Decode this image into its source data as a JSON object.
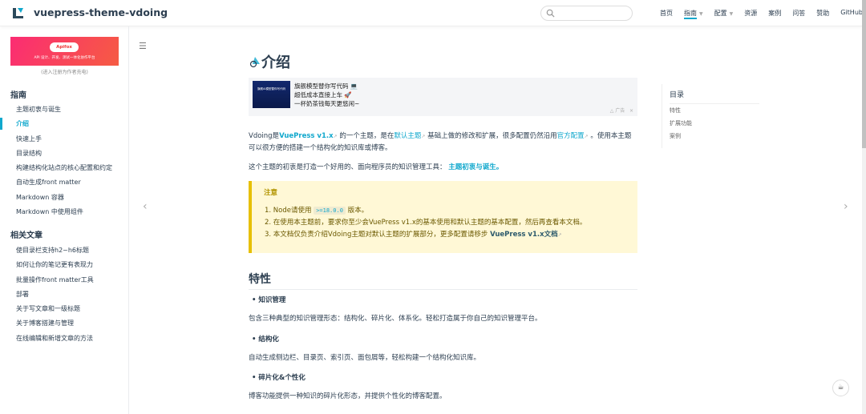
{
  "header": {
    "title": "vuepress-theme-vdoing",
    "search_placeholder": "",
    "nav": [
      {
        "label": "首页"
      },
      {
        "label": "指南",
        "caret": "▼"
      },
      {
        "label": "配置",
        "caret": "▼"
      },
      {
        "label": "资源"
      },
      {
        "label": "案例"
      },
      {
        "label": "问答"
      },
      {
        "label": "赞助"
      },
      {
        "label": "GitHub"
      }
    ]
  },
  "sidebar": {
    "ad": {
      "brand": "Apifox",
      "slogan": "API 设计、开发、测试一体化协作平台",
      "note": "(进入注册为作者充电)"
    },
    "groups": [
      {
        "title": "指南",
        "items": [
          "主题初衷与诞生",
          "介绍",
          "快速上手",
          "目录结构",
          "构建结构化站点的核心配置和约定",
          "自动生成front matter",
          "Markdown 容器",
          "Markdown 中使用组件"
        ]
      },
      {
        "title": "相关文章",
        "items": [
          "使目录栏支持h2~h6标题",
          "如何让你的笔记更有表现力",
          "批量操作front matter工具",
          "部署",
          "关于写文章和一级标题",
          "关于博客搭建与管理",
          "在线编辑和新增文章的方法"
        ]
      }
    ]
  },
  "content": {
    "title": "介绍",
    "banner": {
      "lines": [
        "旗舰模型替你写代码 💻",
        "超低成本直接上车 🚀",
        "一杯奶茶钱每天更悠闲~"
      ],
      "ad_label": "△ 广告",
      "close": "×",
      "image_text": "旗舰AI模型替你写代码"
    },
    "intro": {
      "t1": "Vdoing是",
      "l1": "VuePress v1.x",
      "t2": " 的一个主题，是在",
      "l2": "默认主题",
      "t3": " 基础上做的修改和扩展，很多配置仍然沿用",
      "l3": "官方配置",
      "t4": " 。使用本主题可以很方便的搭建一个结构化的知识库或博客。"
    },
    "purpose": {
      "text": "这个主题的初衷是打造一个好用的、面向程序员的知识管理工具：",
      "link": "主题初衷与诞生。"
    },
    "warning": {
      "title": "注意",
      "item1_a": "1. Node请使用 ",
      "item1_code": ">=18.0.0",
      "item1_b": " 版本。",
      "item2": "2. 在使用本主题前，要求你至少会VuePress v1.x的基本使用和默认主题的基本配置，然后再查看本文档。",
      "item3_a": "3. 本文档仅负责介绍Vdoing主题对默认主题的扩展部分，更多配置请移步 ",
      "item3_link": "VuePress v1.x文档"
    },
    "features": {
      "heading": "特性",
      "items": [
        {
          "title": "知识管理",
          "desc": "包含三种典型的知识管理形态：结构化、碎片化、体系化。轻松打造属于你自己的知识管理平台。"
        },
        {
          "title": "结构化",
          "desc": "自动生成侧边栏、目录页、索引页、面包屑等，轻松构建一个结构化知识库。"
        },
        {
          "title": "碎片化&个性化",
          "desc": "博客功能提供一种知识的碎片化形态，并提供个性化的博客配置。"
        }
      ]
    }
  },
  "toc": {
    "title": "目录",
    "items": [
      "特性",
      "扩展功能",
      "案例"
    ]
  },
  "colors": {
    "accent": "#11a8cd",
    "warning_bg": "#fff8d6",
    "warning_border": "#e7c000"
  }
}
